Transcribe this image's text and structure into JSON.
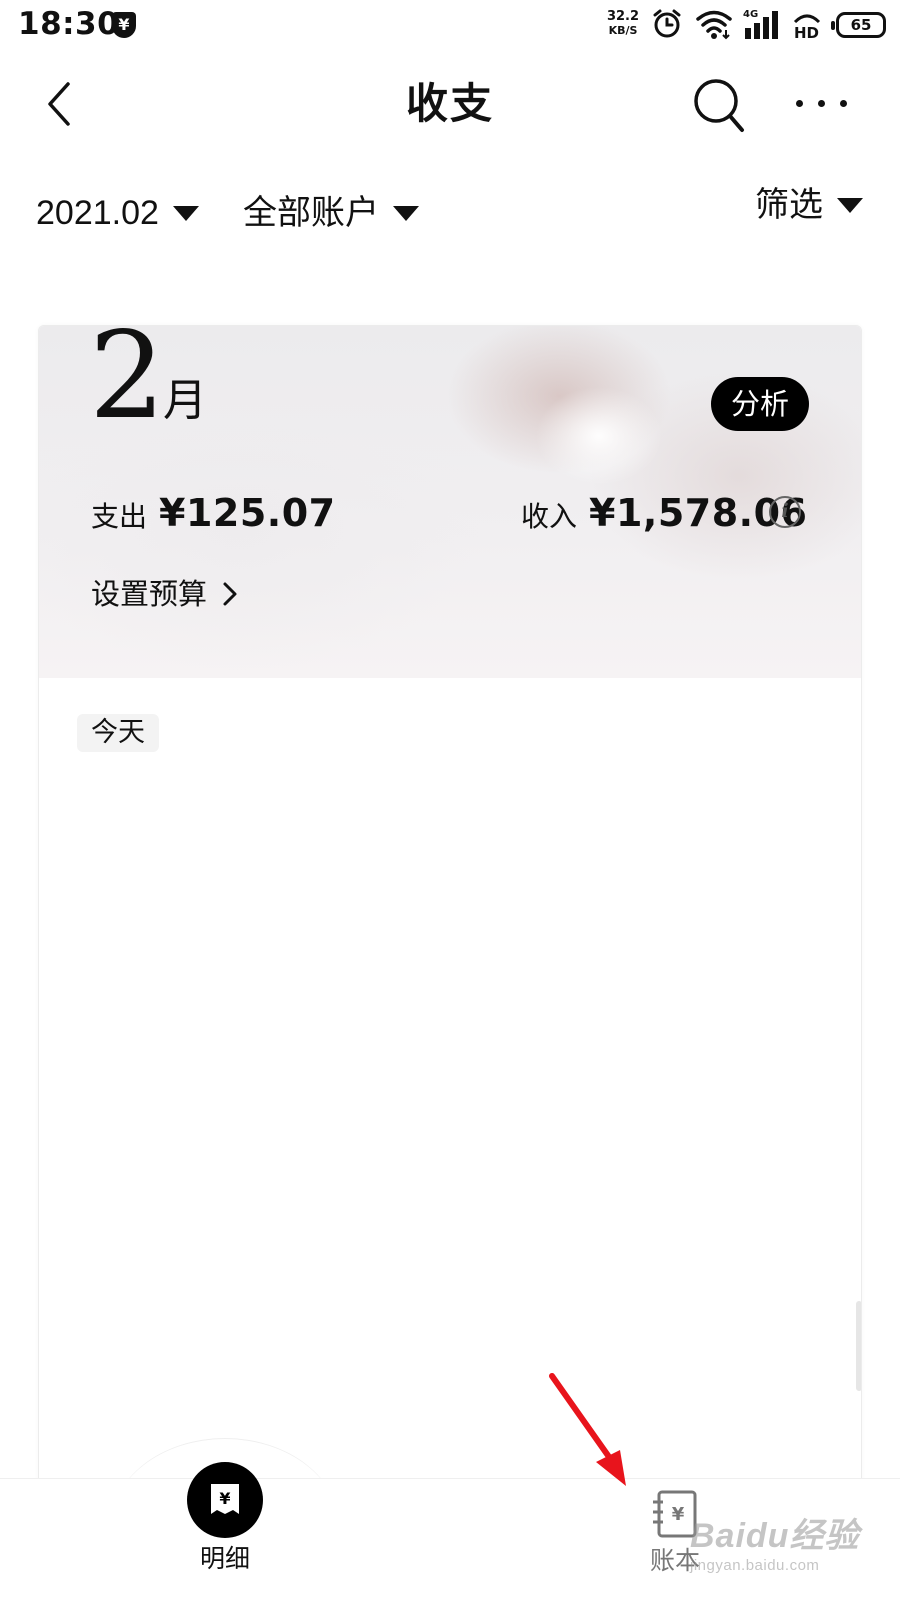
{
  "status_bar": {
    "time": "18:30",
    "net_speed_value": "32.2",
    "net_speed_unit": "KB/S",
    "signal_type": "4G",
    "hd_label": "HD",
    "battery": "65",
    "icons": [
      "shield-yen-icon",
      "alarm-icon",
      "wifi-icon",
      "signal-icon",
      "hd-icon",
      "battery-icon"
    ]
  },
  "header": {
    "title": "收支"
  },
  "filters": {
    "date": "2021.02",
    "account": "全部账户",
    "filter": "筛选"
  },
  "summary": {
    "month_number": "2",
    "month_unit": "月",
    "analysis_label": "分析",
    "expense_label": "支出",
    "expense_value": "¥125.07",
    "income_label": "收入",
    "income_value": "¥1,578.06",
    "info_glyph": "i",
    "budget_label": "设置预算"
  },
  "list": {
    "today_label": "今天"
  },
  "bottom_nav": {
    "tabs": [
      {
        "label": "明细",
        "icon": "receipt-yen-icon",
        "active": true
      },
      {
        "label": "账本",
        "icon": "ledger-yen-icon",
        "active": false
      }
    ]
  },
  "watermark": {
    "main": "Baidu经验",
    "sub": "jingyan.baidu.com"
  },
  "colors": {
    "accent": "#000000",
    "annotation_arrow": "#e8141c"
  }
}
